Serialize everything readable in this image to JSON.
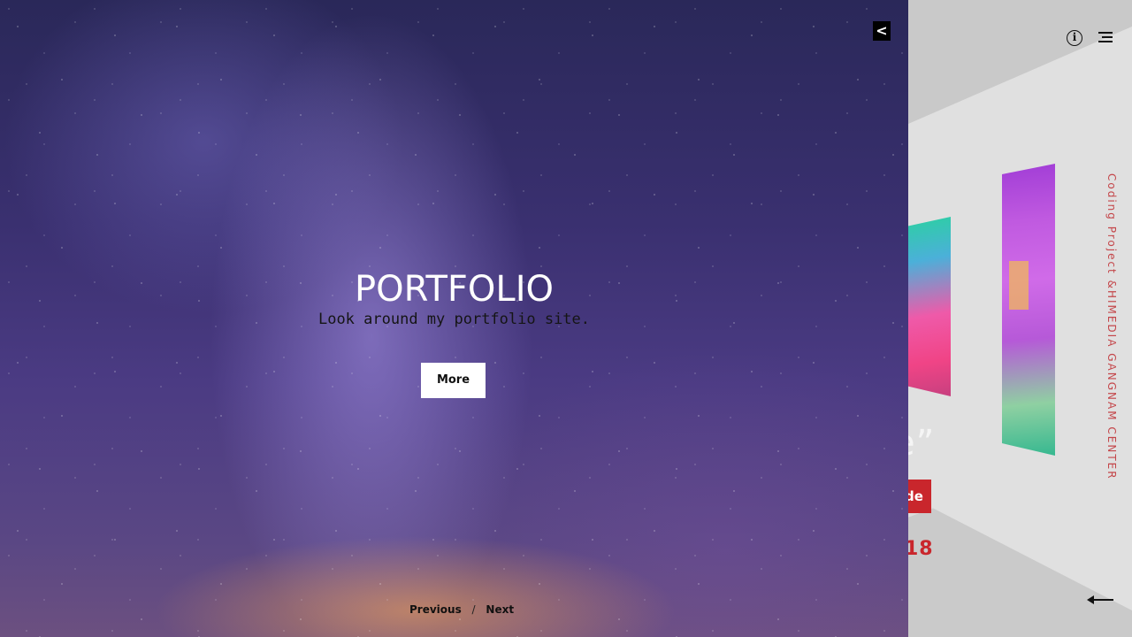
{
  "hero": {
    "title": "PORTFOLIO",
    "subtitle": "Look around my portfolio site.",
    "more_label": "More",
    "close_glyph": "<",
    "pager": {
      "previous": "Previous",
      "separator": "/",
      "next": "Next"
    }
  },
  "gallery": {
    "quote_fragment": "e”",
    "guide_fragment": "de",
    "year_fragment": "18",
    "vertical_caption": "Coding Project &HIMEDIA GANGNAM CENTER",
    "info_glyph": "i",
    "accent_color": "#c9262c"
  }
}
